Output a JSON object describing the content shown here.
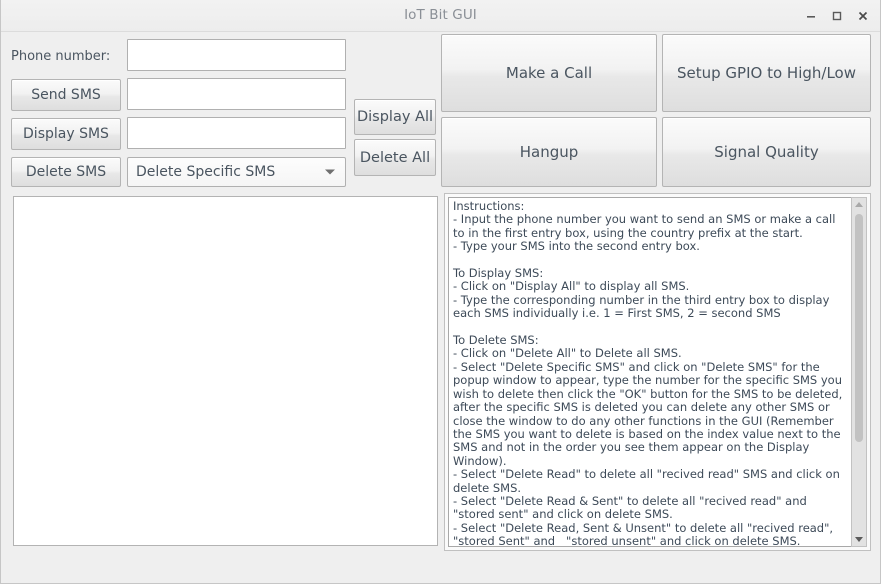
{
  "window": {
    "title": "IoT Bit GUI",
    "controls": {
      "minimize": "minimize-icon",
      "maximize": "maximize-icon",
      "close": "close-icon"
    }
  },
  "form": {
    "phone_label": "Phone number:",
    "phone_value": "",
    "phone_placeholder": "",
    "sms_value": "",
    "sms_placeholder": "",
    "index_value": "",
    "index_placeholder": "",
    "send_sms_label": "Send SMS",
    "display_sms_label": "Display SMS",
    "delete_sms_label": "Delete SMS",
    "display_all_label": "Display All",
    "delete_all_label": "Delete All",
    "delete_mode_selected": "Delete Specific SMS",
    "delete_mode_arrow": "chevron-down-icon"
  },
  "actions": {
    "make_call_label": "Make a Call",
    "gpio_label": "Setup GPIO to High/Low",
    "hangup_label": "Hangup",
    "signal_quality_label": "Signal Quality"
  },
  "display_window": {
    "content": ""
  },
  "instructions": {
    "text": "Instructions:\n- Input the phone number you want to send an SMS or make a call to in the first entry box, using the country prefix at the start.\n- Type your SMS into the second entry box.\n\nTo Display SMS:\n- Click on \"Display All\" to display all SMS.\n- Type the corresponding number in the third entry box to display each SMS individually i.e. 1 = First SMS, 2 = second SMS\n\nTo Delete SMS:\n- Click on \"Delete All\" to Delete all SMS.\n- Select \"Delete Specific SMS\" and click on \"Delete SMS\" for the popup window to appear, type the number for the specific SMS you wish to delete then click the \"OK\" button for the SMS to be deleted, after the specific SMS is deleted you can delete any other SMS or close the window to do any other functions in the GUI (Remember the SMS you want to delete is based on the index value next to the SMS and not in the order you see them appear on the Display Window).\n- Select \"Delete Read\" to delete all \"recived read\" SMS and click on delete SMS.\n- Select \"Delete Read & Sent\" to delete all \"recived read\" and \"stored sent\" and click on delete SMS.\n- Select \"Delete Read, Sent & Unsent\" to delete all \"recived read\", \"stored Sent\" and   \"stored unsent\" and click on delete SMS.\n\nTo set GPIO pins to High/Low:",
    "scroll_up_icon": "triangle-up-icon",
    "scroll_down_icon": "triangle-down-icon"
  },
  "colors": {
    "window_background": "#efefef",
    "text": "#4a5560",
    "title_text": "#8a8f96",
    "entry_background": "#ffffff"
  }
}
